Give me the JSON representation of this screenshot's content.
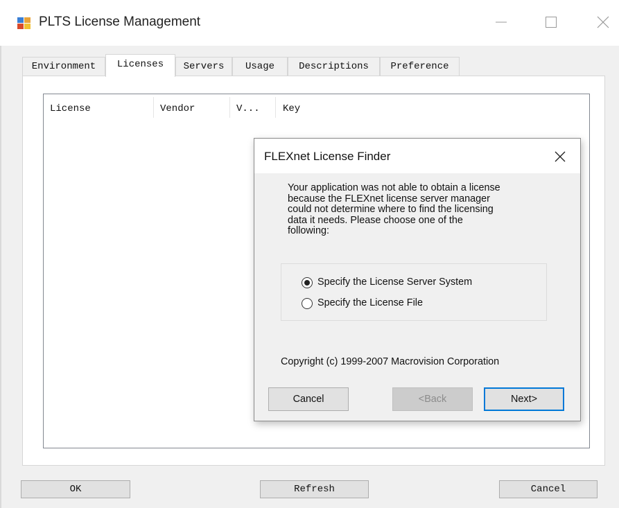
{
  "window": {
    "title": "PLTS License Management",
    "icon": "plts-app-icon",
    "controls": [
      "minimize-icon",
      "maximize-icon",
      "close-icon"
    ]
  },
  "tabs": [
    {
      "label": "Environment",
      "active": false
    },
    {
      "label": "Licenses",
      "active": true
    },
    {
      "label": "Servers",
      "active": false
    },
    {
      "label": "Usage",
      "active": false
    },
    {
      "label": "Descriptions",
      "active": false
    },
    {
      "label": "Preference",
      "active": false
    }
  ],
  "licenses_table": {
    "columns": [
      "License",
      "Vendor",
      "V...",
      "Key"
    ],
    "rows": []
  },
  "buttons": {
    "ok": "OK",
    "refresh": "Refresh",
    "cancel": "Cancel"
  },
  "dialog": {
    "title": "FLEXnet License Finder",
    "message_lines": [
      "Your application was not able to obtain a license",
      "because the FLEXnet license server manager",
      "could not determine where to find the licensing",
      "data it needs.  Please choose one of the",
      "following:"
    ],
    "options": [
      {
        "label": "Specify the License Server System",
        "selected": true
      },
      {
        "label": "Specify the License File",
        "selected": false
      }
    ],
    "copyright": "Copyright (c) 1999-2007 Macrovision Corporation",
    "buttons": {
      "cancel": "Cancel",
      "back": "<Back",
      "next": "Next>"
    },
    "back_enabled": false,
    "default_button": "next"
  },
  "colors": {
    "focus_border": "#0078d7",
    "window_bg": "#f0f0f0",
    "button_bg": "#e1e1e1",
    "disabled_text": "#8c8c8c"
  }
}
